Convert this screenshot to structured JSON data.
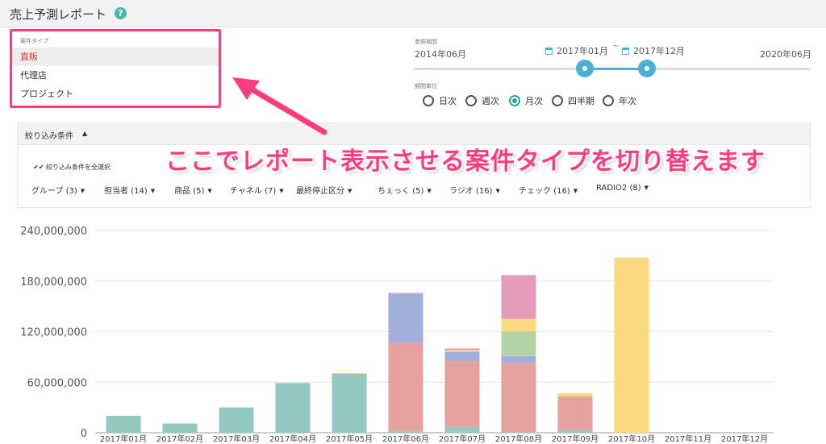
{
  "header": {
    "title": "売上予測レポート",
    "help_icon": "help-circle-icon"
  },
  "type_panel": {
    "caption": "案件タイプ",
    "items": [
      {
        "label": "直販",
        "active": true
      },
      {
        "label": "代理店",
        "active": false
      },
      {
        "label": "プロジェクト",
        "active": false
      }
    ]
  },
  "period": {
    "caption": "参照期間",
    "range_start": "2014年06月",
    "range_end": "2020年06月",
    "selected_start": "2017年01月",
    "selected_end": "2017年12月",
    "separator": "~"
  },
  "unit": {
    "caption": "期間単位",
    "options": [
      {
        "label": "日次",
        "selected": false
      },
      {
        "label": "週次",
        "selected": false
      },
      {
        "label": "月次",
        "selected": true
      },
      {
        "label": "四半期",
        "selected": false
      },
      {
        "label": "年次",
        "selected": false
      }
    ]
  },
  "filter": {
    "title": "絞り込み条件",
    "select_all": "絞り込み条件を全選択",
    "dropdowns": [
      "グループ (3)",
      "担当者 (14)",
      "商品 (5)",
      "チャネル (7)",
      "最終停止区分",
      "ちぇっく (5)",
      "ラジオ (16)",
      "チェック (16)",
      "RADIO2 (8)"
    ]
  },
  "annotation": "ここでレポート表示させる案件タイプを切り替えます",
  "colors": {
    "accent_pink": "#ff3c7e",
    "slider_blue": "#4ab0d8",
    "radio_teal": "#26a69a",
    "series": [
      "#93c9c1",
      "#e4a19e",
      "#a3afdb",
      "#b3d3a4",
      "#fad980",
      "#e49ab8"
    ]
  },
  "chart_data": {
    "type": "bar",
    "stacked": true,
    "categories": [
      "2017年01月",
      "2017年02月",
      "2017年03月",
      "2017年04月",
      "2017年05月",
      "2017年06月",
      "2017年07月",
      "2017年08月",
      "2017年09月",
      "2017年10月",
      "2017年11月",
      "2017年12月"
    ],
    "ylim": [
      0,
      240000000
    ],
    "yticks": [
      "0",
      "60,000,000",
      "120,000,000",
      "180,000,000",
      "240,000,000"
    ],
    "grid": true,
    "series": [
      {
        "values": [
          20000000,
          11000000,
          30000000,
          59000000,
          70000000,
          2000000,
          7000000,
          1000000,
          3000000,
          0,
          0,
          0
        ]
      },
      {
        "values": [
          0,
          0,
          0,
          0,
          0,
          105000000,
          78000000,
          82000000,
          40000000,
          0,
          0,
          0
        ]
      },
      {
        "values": [
          0,
          0,
          0,
          0,
          0,
          58000000,
          11000000,
          8000000,
          0,
          0,
          0,
          0
        ]
      },
      {
        "values": [
          0,
          0,
          0,
          0,
          0,
          0,
          0,
          29000000,
          0,
          0,
          0,
          0
        ]
      },
      {
        "values": [
          0,
          0,
          0,
          0,
          1000000,
          0,
          2000000,
          15000000,
          4000000,
          208000000,
          0,
          0
        ]
      },
      {
        "values": [
          0,
          0,
          0,
          0,
          0,
          1000000,
          2000000,
          52000000,
          0,
          0,
          0,
          0
        ]
      }
    ]
  }
}
